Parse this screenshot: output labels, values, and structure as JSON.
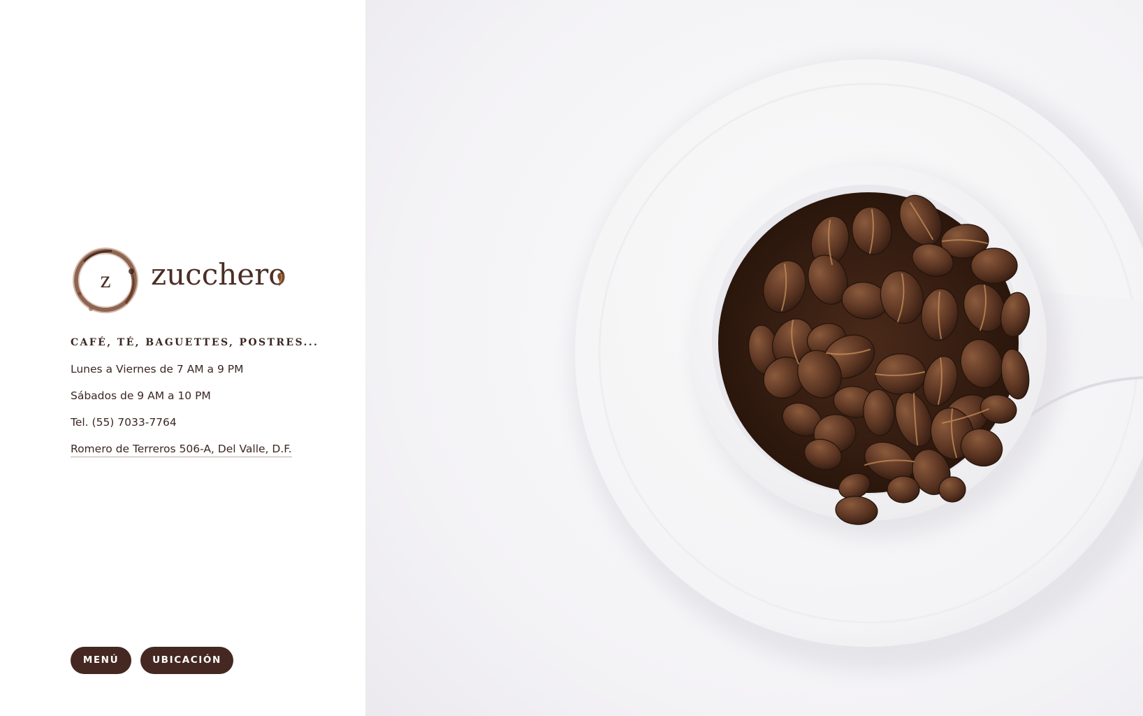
{
  "brand": {
    "initial": "z",
    "name": "zucchero",
    "logo_color": "#4a2e26"
  },
  "info": {
    "tagline": "CAFÉ, TÉ, BAGUETTES, POSTRES...",
    "hours_weekdays": "Lunes a Viernes de 7 AM a 9 PM",
    "hours_saturday": "Sábados de 9 AM a 10 PM",
    "phone": "Tel. (55) 7033-7764",
    "address": "Romero de Terreros 506-A, Del Valle, D.F."
  },
  "buttons": {
    "menu_label": "MENÚ",
    "location_label": "UBICACIÓN",
    "color": "#452822"
  },
  "hero": {
    "image_subject": "coffee-beans-in-white-cup-photo"
  },
  "colors": {
    "text": "#3b2723",
    "accent": "#452822",
    "background": "#ffffff"
  }
}
